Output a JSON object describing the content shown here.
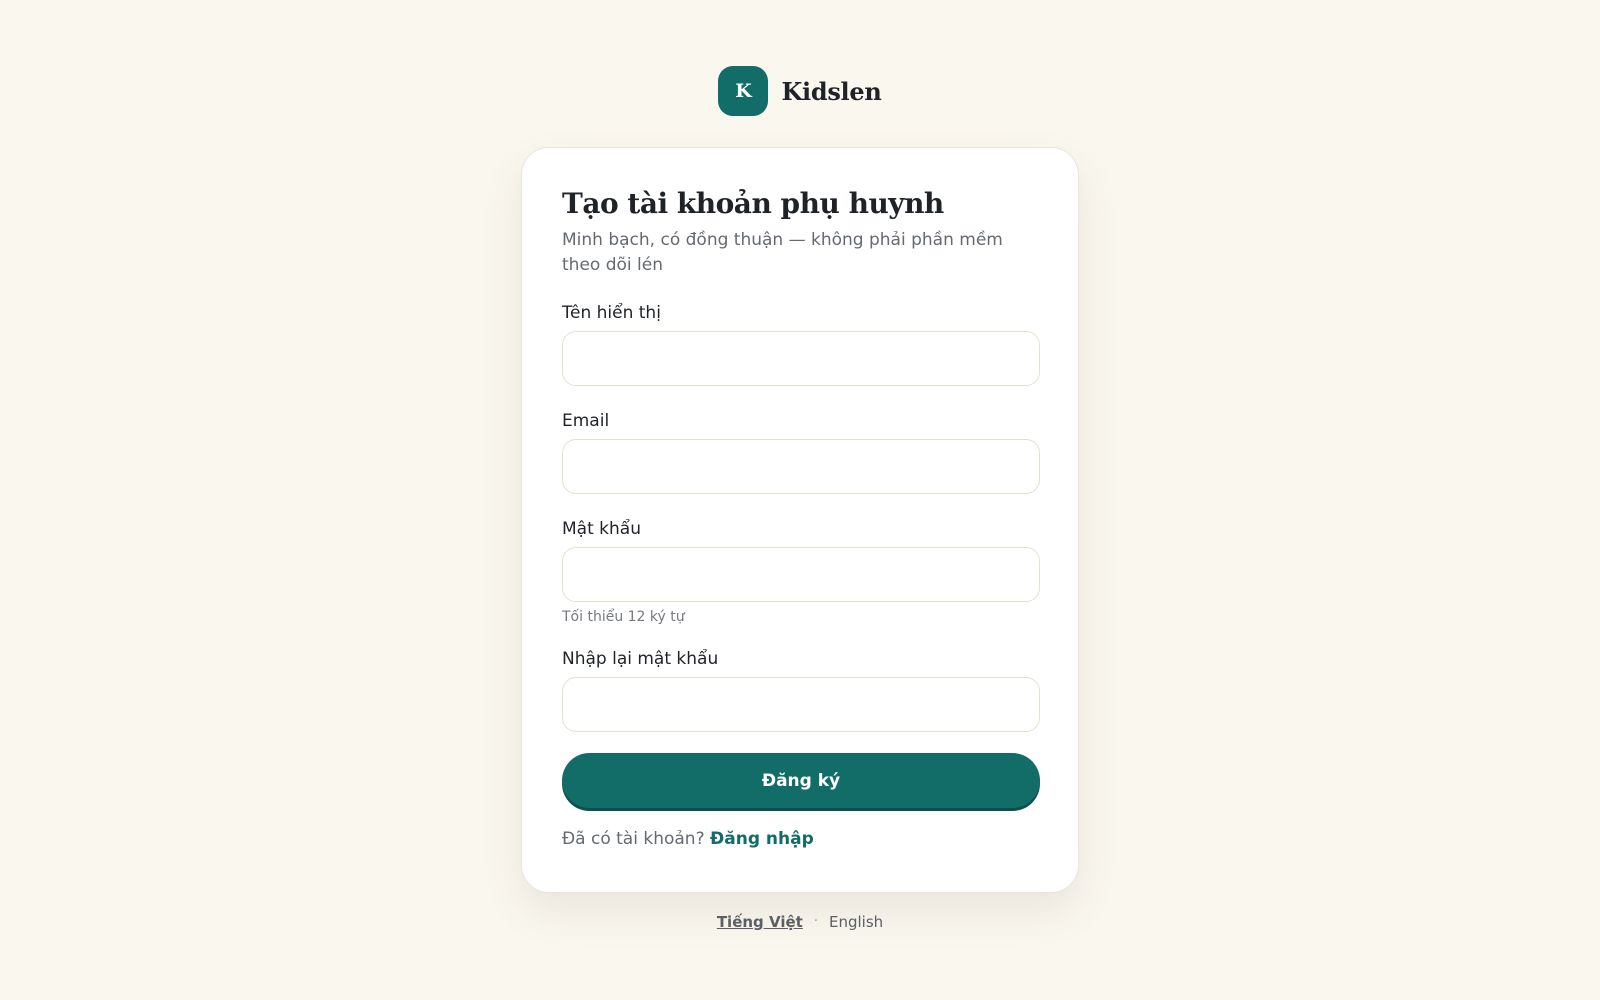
{
  "brand": {
    "logo_letter": "K",
    "name": "Kidslen"
  },
  "form": {
    "title": "Tạo tài khoản phụ huynh",
    "subtitle": "Minh bạch, có đồng thuận — không phải phần mềm theo dõi lén",
    "fields": {
      "display_name": {
        "label": "Tên hiển thị",
        "value": ""
      },
      "email": {
        "label": "Email",
        "value": ""
      },
      "password": {
        "label": "Mật khẩu",
        "value": "",
        "hint": "Tối thiểu 12 ký tự"
      },
      "confirm_password": {
        "label": "Nhập lại mật khẩu",
        "value": ""
      }
    },
    "submit_label": "Đăng ký",
    "signin_prompt": "Đã có tài khoản?",
    "signin_link": "Đăng nhập"
  },
  "languages": {
    "active": "Tiếng Việt",
    "separator": "·",
    "other": "English"
  },
  "colors": {
    "accent": "#126d69",
    "background": "#faf7ef",
    "card": "#ffffff"
  }
}
